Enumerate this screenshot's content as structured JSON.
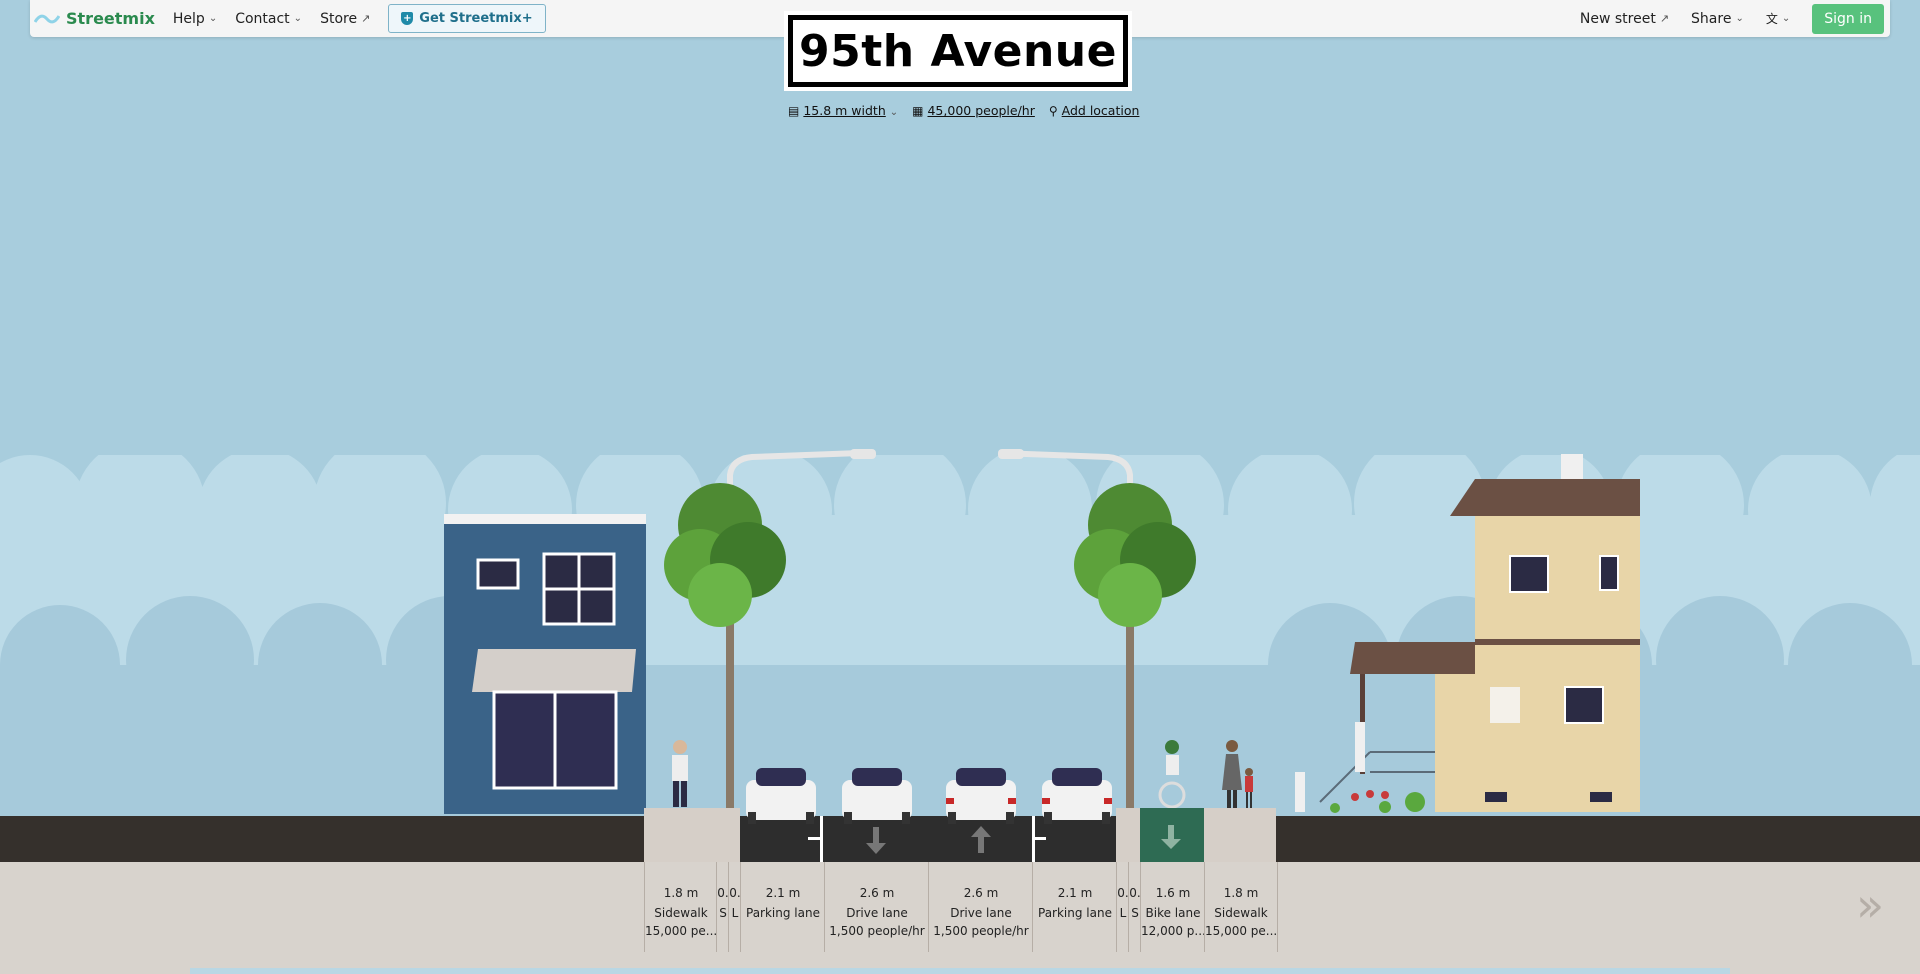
{
  "topbar": {
    "logo_text": "Streetmix",
    "help": "Help",
    "contact": "Contact",
    "store": "Store",
    "get_plus": "Get Streetmix+",
    "new_street": "New street",
    "share": "Share",
    "language_icon": "translate-icon",
    "sign_in": "Sign in"
  },
  "street": {
    "name": "95th Avenue",
    "width": "15.8 m width",
    "capacity": "45,000 people/hr",
    "location": "Add location"
  },
  "segments": [
    {
      "width": "1.8 m",
      "name": "Sidewalk",
      "capacity": "15,000 pe..."
    },
    {
      "width": "0.",
      "name": "S",
      "capacity": ""
    },
    {
      "width": "0.",
      "name": "L",
      "capacity": ""
    },
    {
      "width": "2.1 m",
      "name": "Parking lane",
      "capacity": ""
    },
    {
      "width": "2.6 m",
      "name": "Drive lane",
      "capacity": "1,500 people/hr"
    },
    {
      "width": "2.6 m",
      "name": "Drive lane",
      "capacity": "1,500 people/hr"
    },
    {
      "width": "2.1 m",
      "name": "Parking lane",
      "capacity": ""
    },
    {
      "width": "0.",
      "name": "L",
      "capacity": ""
    },
    {
      "width": "0.",
      "name": "S",
      "capacity": ""
    },
    {
      "width": "1.6 m",
      "name": "Bike lane",
      "capacity": "12,000 p..."
    },
    {
      "width": "1.8 m",
      "name": "Sidewalk",
      "capacity": "15,000 pe..."
    }
  ],
  "colors": {
    "sky": "#a8cddd",
    "brand": "#2a8a4e",
    "sign_in": "#58c27d",
    "bike_lane": "#2e6b53",
    "asphalt": "#2d2d2d"
  }
}
